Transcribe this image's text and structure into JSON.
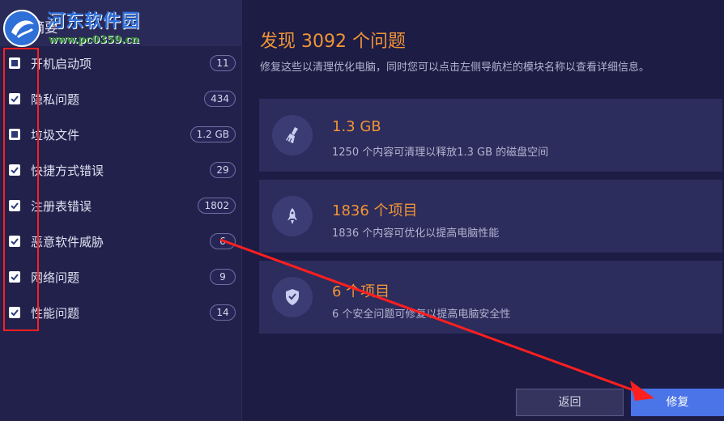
{
  "watermark": {
    "title": "河东软件园",
    "url": "www.pc0359.cn"
  },
  "sidebar": {
    "title": "摘要",
    "items": [
      {
        "label": "开机启动项",
        "badge": "11",
        "checked": "partial"
      },
      {
        "label": "隐私问题",
        "badge": "434",
        "checked": "true"
      },
      {
        "label": "垃圾文件",
        "badge": "1.2 GB",
        "checked": "partial"
      },
      {
        "label": "快捷方式错误",
        "badge": "29",
        "checked": "true"
      },
      {
        "label": "注册表错误",
        "badge": "1802",
        "checked": "true"
      },
      {
        "label": "恶意软件威胁",
        "badge": "6",
        "checked": "true"
      },
      {
        "label": "网络问题",
        "badge": "9",
        "checked": "true"
      },
      {
        "label": "性能问题",
        "badge": "14",
        "checked": "true"
      }
    ]
  },
  "main": {
    "headline": "发现 3092 个问题",
    "subtitle": "修复这些以清理优化电脑，同时您可以点击左侧导航栏的模块名称以查看详细信息。",
    "cards": [
      {
        "icon": "broom-icon",
        "title": "1.3 GB",
        "desc": "1250 个内容可清理以释放1.3 GB 的磁盘空间"
      },
      {
        "icon": "rocket-icon",
        "title": "1836 个项目",
        "desc": "1836 个内容可优化以提高电脑性能"
      },
      {
        "icon": "shield-icon",
        "title": "6 个项目",
        "desc": "6 个安全问题可修复以提高电脑安全性"
      }
    ]
  },
  "buttons": {
    "back": "返回",
    "fix": "修复"
  },
  "colors": {
    "accent_orange": "#f09436",
    "primary_blue": "#4a74e8",
    "annotation_red": "#ff1f1f",
    "background": "#1c1c45"
  }
}
